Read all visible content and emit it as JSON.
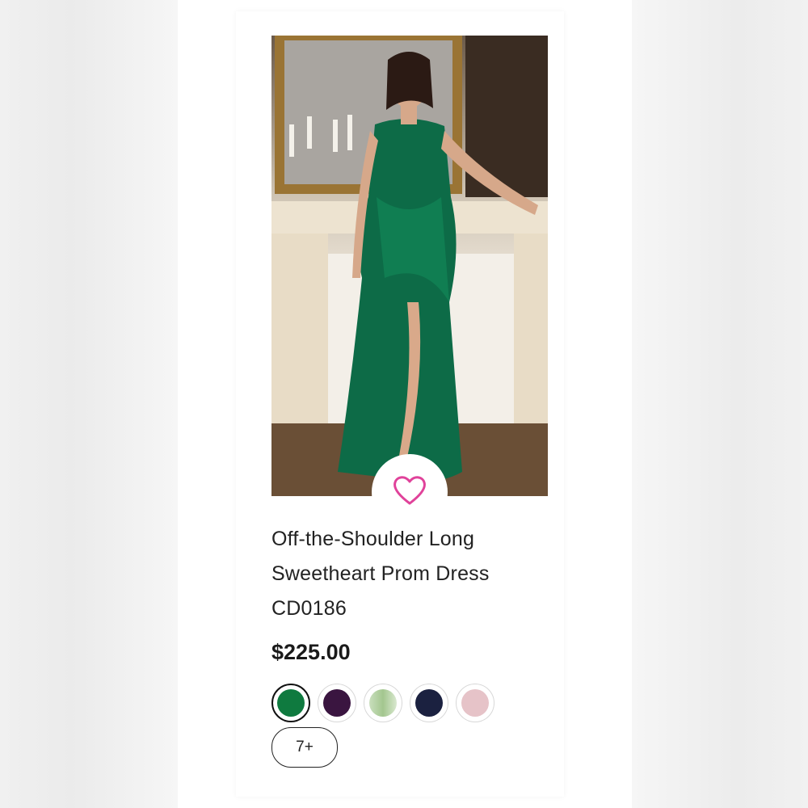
{
  "product": {
    "title_line1": "Off-the-Shoulder Long",
    "title_line2": "Sweetheart Prom Dress",
    "title_line3": "CD0186",
    "price": "$225.00",
    "wishlist_icon": "heart-icon",
    "accent_color": "#e0429a",
    "more_colors_label": "7+",
    "swatches": [
      {
        "name": "emerald",
        "color": "#0f7a3f",
        "selected": true
      },
      {
        "name": "plum",
        "color": "#3a1540",
        "selected": false
      },
      {
        "name": "sage",
        "color": "#a9c89a",
        "selected": false
      },
      {
        "name": "navy",
        "color": "#1b2140",
        "selected": false
      },
      {
        "name": "blush",
        "color": "#e6c3c8",
        "selected": false
      }
    ]
  }
}
